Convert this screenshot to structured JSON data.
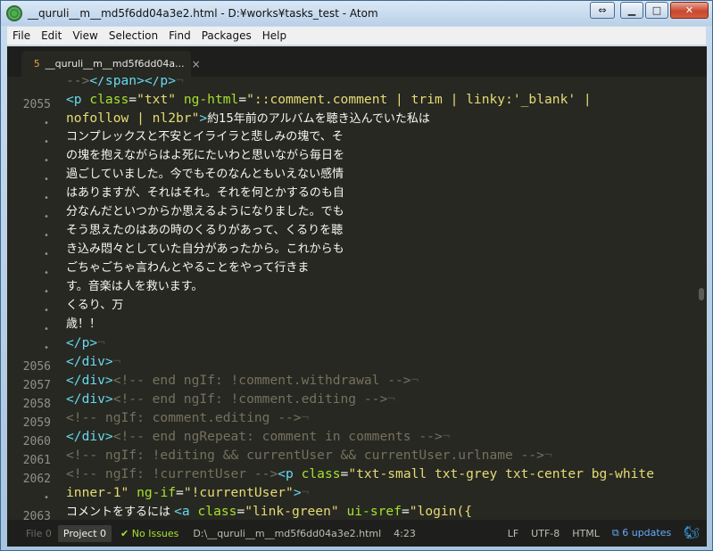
{
  "window": {
    "title": "__quruli__m__md5f6dd04a3e2.html - D:¥works¥tasks_test - Atom",
    "controls": {
      "swap": "⇔",
      "minimize": "▁",
      "maximize": "□",
      "close": "✕"
    }
  },
  "menu": [
    "File",
    "Edit",
    "View",
    "Selection",
    "Find",
    "Packages",
    "Help"
  ],
  "tab": {
    "icon": "5",
    "title": "__quruli__m__md5f6dd04a...",
    "close": "×"
  },
  "gutter": [
    "",
    "2055",
    "•",
    "•",
    "•",
    "•",
    "•",
    "•",
    "•",
    "•",
    "•",
    "•",
    "•",
    "•",
    "•",
    "2056",
    "2057",
    "2058",
    "2059",
    "2060",
    "2061",
    "2062",
    "•",
    "2063"
  ],
  "code": {
    "l0": {
      "a": "-->",
      "b": "</span></p>",
      "c": "¬"
    },
    "l1": {
      "a": "<p ",
      "b": "class",
      "c": "=",
      "d": "\"txt\"",
      "e": " ng-html",
      "f": "=",
      "g": "\"::comment.comment | trim | linky:'_blank' |"
    },
    "l2": {
      "a": "nofollow | nl2br\"",
      "b": ">",
      "c": "約15年前のアルバムを聴き込んでいた私は"
    },
    "l3": "コンプレックスと不安とイライラと悲しみの塊で、そ",
    "l4": "の塊を抱えながらはよ死にたいわと思いながら毎日を",
    "l5": "過ごしていました。今でもそのなんともいえない感情",
    "l6": "はありますが、それはそれ。それを何とかするのも自",
    "l7": "分なんだといつからか思えるようになりました。でも",
    "l8": "そう思えたのはあの時のくるりがあって、くるりを聴",
    "l9": "き込み悶々としていた自分があったから。これからも",
    "l10": "ごちゃごちゃ言わんとやることをやって行きま",
    "l11": "す。音楽は人を救います。",
    "l12": "くるり、万",
    "l13": "歳！！",
    "l14": {
      "a": "</p>",
      "b": "¬"
    },
    "l15": {
      "a": "</div>",
      "b": "¬"
    },
    "l16": {
      "a": "</div>",
      "b": "<!-- end ngIf: !comment.withdrawal -->",
      "c": "¬"
    },
    "l17": {
      "a": "</div>",
      "b": "<!-- end ngIf: !comment.editing -->",
      "c": "¬"
    },
    "l18": {
      "a": "<!-- ngIf: comment.editing -->",
      "b": "¬"
    },
    "l19": {
      "a": "</div>",
      "b": "<!-- end ngRepeat: comment in comments -->",
      "c": "¬"
    },
    "l20": {
      "a": "<!-- ngIf: !editing && currentUser && currentUser.urlname -->",
      "b": "¬"
    },
    "l21": {
      "a": "<!-- ngIf: !currentUser -->",
      "b": "<p ",
      "c": "class",
      "d": "=",
      "e": "\"txt-small txt-grey txt-center bg-white"
    },
    "l22": {
      "a": "inner-1\"",
      "b": " ng-if",
      "c": "=",
      "d": "\"!currentUser\"",
      "e": ">",
      "f": "¬"
    },
    "l23": {
      "a": "コメントをするには ",
      "b": "<a ",
      "c": "class",
      "d": "=",
      "e": "\"link-green\"",
      "f": " ui-sref",
      "g": "=",
      "h": "\"login({"
    }
  },
  "status": {
    "file_tab": "File 0",
    "project_tab": "Project 0",
    "issues": "✔ No Issues",
    "path": "D:\\__quruli__m__md5f6dd04a3e2.html",
    "position": "4:23",
    "line_ending": "LF",
    "encoding": "UTF-8",
    "grammar": "HTML",
    "updates": "6 updates"
  },
  "colors": {
    "background": "#272822",
    "tag": "#66d9ef",
    "attribute": "#a6e22e",
    "string": "#e6db74",
    "comment": "#75715e"
  }
}
